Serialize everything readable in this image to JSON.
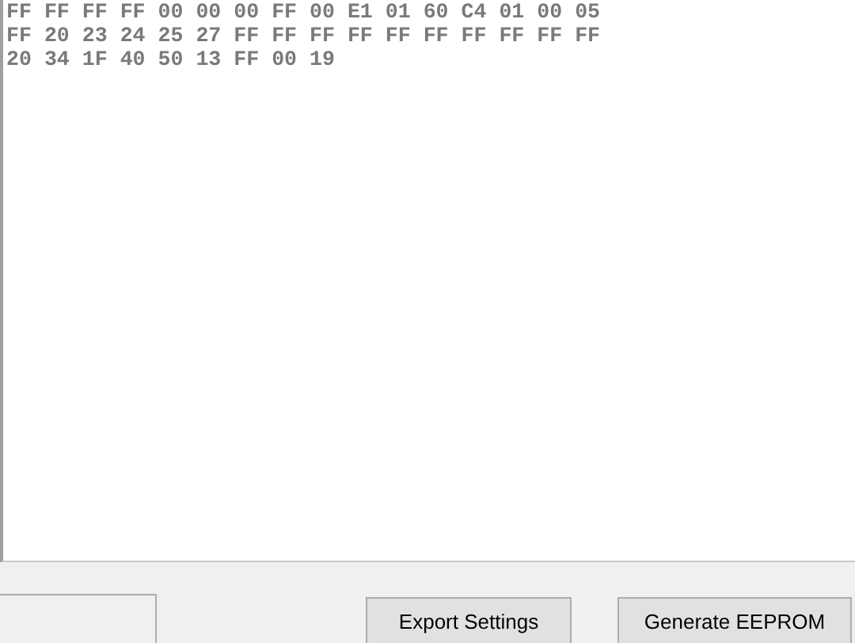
{
  "hex_output": {
    "lines": [
      "FF FF FF FF 00 00 00 FF 00 E1 01 60 C4 01 00 05",
      "FF 20 23 24 25 27 FF FF FF FF FF FF FF FF FF FF",
      "20 34 1F 40 50 13 FF 00 19"
    ]
  },
  "buttons": [
    "Export Settings",
    "Generate EEPROM"
  ]
}
